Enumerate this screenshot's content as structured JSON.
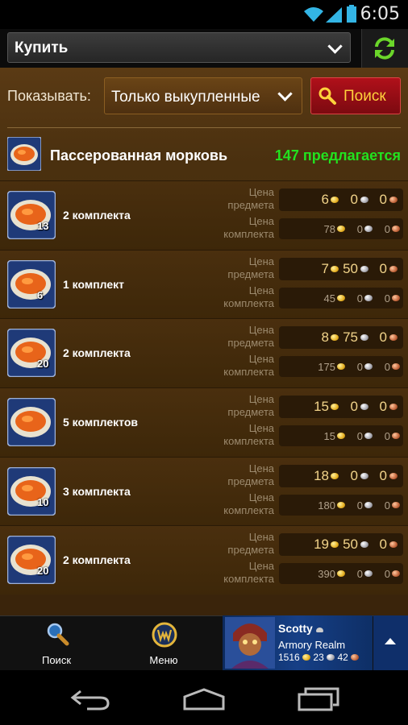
{
  "status": {
    "time": "6:05"
  },
  "toolbar": {
    "mode_label": "Купить"
  },
  "filter": {
    "show_label": "Показывать:",
    "show_value": "Только выкупленные",
    "search_label": "Поиск"
  },
  "item": {
    "name": "Пассерованная морковь",
    "offers": "147 предлагается"
  },
  "labels": {
    "item_price": "Цена\nпредмета",
    "stack_price": "Цена\nкомплекта"
  },
  "listings": [
    {
      "count": "13",
      "label": "2 комплекта",
      "item_price": {
        "g": "6",
        "s": "0",
        "c": "0"
      },
      "stack_price": {
        "g": "78",
        "s": "0",
        "c": "0"
      }
    },
    {
      "count": "6",
      "label": "1 комплект",
      "item_price": {
        "g": "7",
        "s": "50",
        "c": "0"
      },
      "stack_price": {
        "g": "45",
        "s": "0",
        "c": "0"
      }
    },
    {
      "count": "20",
      "label": "2 комплекта",
      "item_price": {
        "g": "8",
        "s": "75",
        "c": "0"
      },
      "stack_price": {
        "g": "175",
        "s": "0",
        "c": "0"
      }
    },
    {
      "count": "",
      "label": "5 комплектов",
      "item_price": {
        "g": "15",
        "s": "0",
        "c": "0"
      },
      "stack_price": {
        "g": "15",
        "s": "0",
        "c": "0"
      }
    },
    {
      "count": "10",
      "label": "3 комплекта",
      "item_price": {
        "g": "18",
        "s": "0",
        "c": "0"
      },
      "stack_price": {
        "g": "180",
        "s": "0",
        "c": "0"
      }
    },
    {
      "count": "20",
      "label": "2 комплекта",
      "item_price": {
        "g": "19",
        "s": "50",
        "c": "0"
      },
      "stack_price": {
        "g": "390",
        "s": "0",
        "c": "0"
      }
    }
  ],
  "bottom_nav": {
    "search_label": "Поиск",
    "menu_label": "Меню"
  },
  "character": {
    "name": "Scotty",
    "realm": "Armory Realm",
    "gold": "1516",
    "silver": "23",
    "copper": "42"
  },
  "colors": {
    "offers": "#22e21f",
    "search_button": "#b0101a",
    "search_text": "#ffd23c",
    "panel": "#4a300f"
  }
}
